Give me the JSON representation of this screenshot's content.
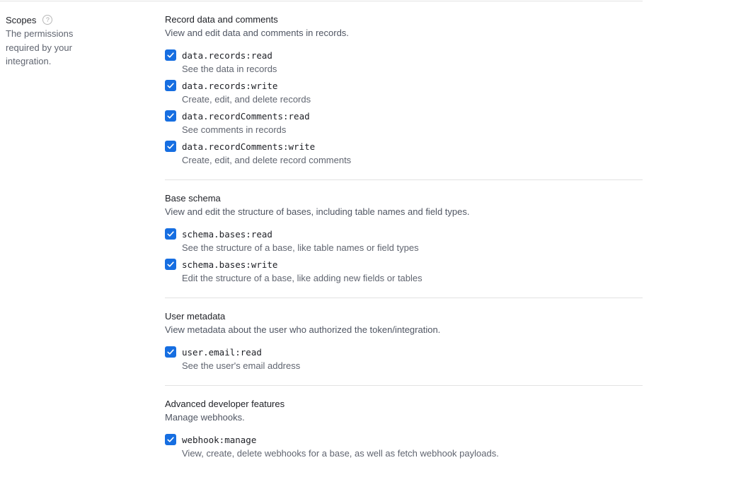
{
  "scopes_panel": {
    "title": "Scopes",
    "description": "The permissions required by your integration.",
    "help_icon": "question-circle-icon"
  },
  "sections": [
    {
      "title": "Record data and comments",
      "description": "View and edit data and comments in records.",
      "scopes": [
        {
          "name": "data.records:read",
          "description": "See the data in records",
          "checked": true
        },
        {
          "name": "data.records:write",
          "description": "Create, edit, and delete records",
          "checked": true
        },
        {
          "name": "data.recordComments:read",
          "description": "See comments in records",
          "checked": true
        },
        {
          "name": "data.recordComments:write",
          "description": "Create, edit, and delete record comments",
          "checked": true
        }
      ]
    },
    {
      "title": "Base schema",
      "description": "View and edit the structure of bases, including table names and field types.",
      "scopes": [
        {
          "name": "schema.bases:read",
          "description": "See the structure of a base, like table names or field types",
          "checked": true
        },
        {
          "name": "schema.bases:write",
          "description": "Edit the structure of a base, like adding new fields or tables",
          "checked": true
        }
      ]
    },
    {
      "title": "User metadata",
      "description": "View metadata about the user who authorized the token/integration.",
      "scopes": [
        {
          "name": "user.email:read",
          "description": "See the user's email address",
          "checked": true
        }
      ]
    },
    {
      "title": "Advanced developer features",
      "description": "Manage webhooks.",
      "scopes": [
        {
          "name": "webhook:manage",
          "description": "View, create, delete webhooks for a base, as well as fetch webhook payloads.",
          "checked": true
        }
      ]
    }
  ],
  "colors": {
    "checkbox_fill": "#166ee1",
    "divider": "#e2e2e2"
  }
}
